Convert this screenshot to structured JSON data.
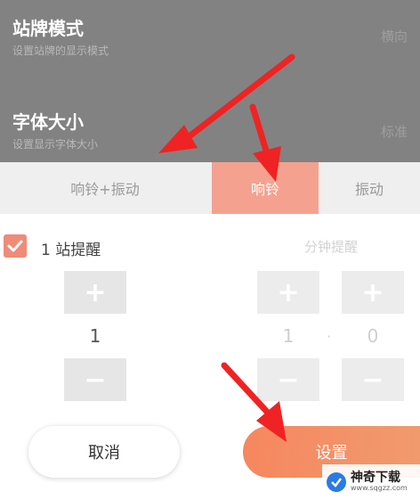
{
  "settings": [
    {
      "title": "站牌模式",
      "subtitle": "设置站牌的显示模式",
      "value": "横向"
    },
    {
      "title": "字体大小",
      "subtitle": "设置显示字体大小",
      "value": "标准"
    }
  ],
  "tabs": [
    {
      "label": "响铃+振动",
      "active": false
    },
    {
      "label": "响铃",
      "active": true
    },
    {
      "label": "振动",
      "active": false
    }
  ],
  "stations_reminder": {
    "checked": true,
    "count": "1",
    "unit_label": "站提醒"
  },
  "time_reminder": {
    "label": "分钟提醒",
    "left_value": "1",
    "right_value": "0"
  },
  "stepper": {
    "plus": "+",
    "minus": "−"
  },
  "buttons": {
    "cancel": "取消",
    "confirm": "设置"
  },
  "watermark": {
    "name": "神奇下载",
    "url": "www.sqgzz.com"
  },
  "colors": {
    "accent": "#f08b78",
    "tab_active": "#f4a28f",
    "confirm": "#f6875f",
    "arrow": "#ef2323"
  },
  "icons": [
    "checkmark-icon",
    "annotation-arrow",
    "watermark-logo-icon"
  ]
}
